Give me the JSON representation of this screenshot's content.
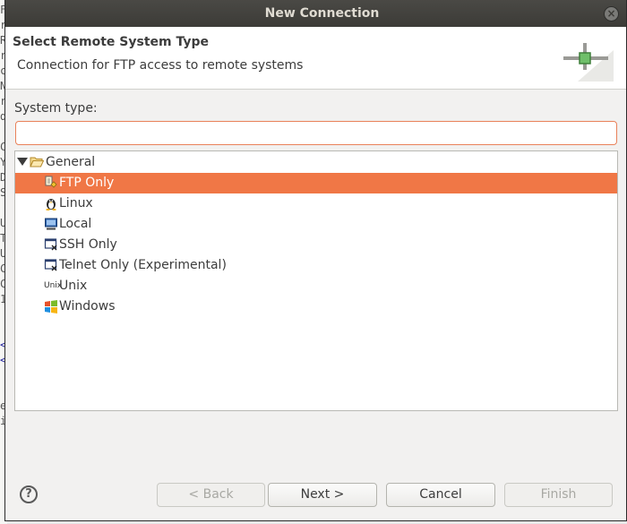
{
  "background_window": {
    "fragments": [
      "F",
      "r",
      "R",
      "r",
      "c",
      "N",
      "r",
      "d",
      "",
      "C",
      "Y",
      "D",
      "S",
      "",
      "U",
      "T",
      "U",
      "C",
      "C",
      "1",
      "",
      "",
      "<",
      "<",
      "",
      "",
      "e",
      "i"
    ]
  },
  "dialog": {
    "title": "New Connection",
    "close_glyph": "×"
  },
  "header": {
    "title": "Select Remote System Type",
    "description": "Connection for FTP access to remote systems"
  },
  "system_type": {
    "label": "System type:",
    "value": ""
  },
  "tree": {
    "root": {
      "label": "General",
      "expanded": true,
      "icon": "folder-open-icon"
    },
    "items": [
      {
        "label": "FTP Only",
        "icon": "ftp-icon",
        "selected": true
      },
      {
        "label": "Linux",
        "icon": "linux-penguin-icon",
        "selected": false
      },
      {
        "label": "Local",
        "icon": "local-computer-icon",
        "selected": false
      },
      {
        "label": "SSH Only",
        "icon": "ssh-terminal-icon",
        "selected": false
      },
      {
        "label": "Telnet Only (Experimental)",
        "icon": "telnet-terminal-icon",
        "selected": false
      },
      {
        "label": "Unix",
        "icon": "unix-text-icon",
        "icon_text": "Unix",
        "selected": false
      },
      {
        "label": "Windows",
        "icon": "windows-flag-icon",
        "selected": false
      }
    ]
  },
  "footer": {
    "help_glyph": "?",
    "back_label": "< Back",
    "next_label": "Next >",
    "cancel_label": "Cancel",
    "finish_label": "Finish"
  },
  "colors": {
    "selection": "#f07746",
    "input_focus_border": "#e9825a",
    "titlebar": "#3c3b37"
  }
}
